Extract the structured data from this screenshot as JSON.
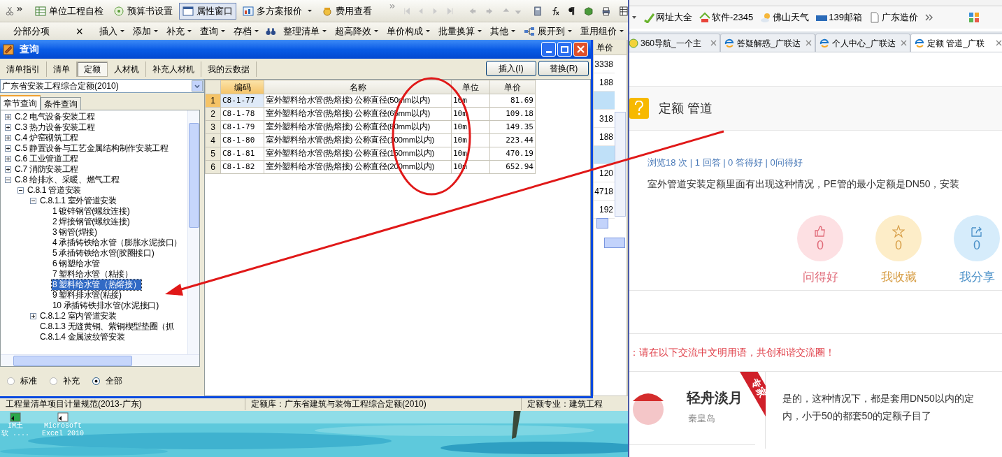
{
  "app": {
    "toolbar1": [
      {
        "label": "单位工程自检",
        "pressed": false
      },
      {
        "label": "预算书设置",
        "pressed": false
      },
      {
        "label": "属性窗口",
        "pressed": true
      },
      {
        "label": "多方案报价",
        "pressed": false
      },
      {
        "label": "费用查看",
        "pressed": false
      }
    ],
    "panel_title": "分部分项",
    "panel_close": "×",
    "toolbar2": [
      "插入",
      "添加",
      "补充",
      "查询",
      "存档",
      "整理清单",
      "超高降效",
      "单价构成",
      "批量换算",
      "其他",
      "展开到",
      "重用组价"
    ],
    "side_column": {
      "header": "单价",
      "values": [
        {
          "text": "3338",
          "highlight": false
        },
        {
          "text": "188",
          "highlight": false
        },
        {
          "highlight": true
        },
        {
          "text": "318",
          "highlight": false
        },
        {
          "text": "188",
          "highlight": false
        },
        {
          "highlight": true
        },
        {
          "text": "120",
          "highlight": false
        },
        {
          "text": "4718",
          "highlight": false
        },
        {
          "text": "192",
          "highlight": false
        }
      ]
    },
    "status_bar": [
      "工程量清单项目计量规范(2013-广东)",
      "定额库：广东省建筑与装饰工程综合定额(2010)",
      "定额专业：建筑工程"
    ]
  },
  "dialog": {
    "title": "查询",
    "tabs": [
      {
        "label": "清单指引",
        "selected": false
      },
      {
        "label": "清单",
        "selected": false
      },
      {
        "label": "定额",
        "selected": true
      },
      {
        "label": "人材机",
        "selected": false
      },
      {
        "label": "补充人材机",
        "selected": false
      },
      {
        "label": "我的云数据",
        "selected": false
      }
    ],
    "buttons": [
      "插入(I)",
      "替换(R)"
    ],
    "library": "广东省安装工程综合定额(2010)",
    "subtabs": [
      {
        "label": "章节查询",
        "selected": true
      },
      {
        "label": "条件查询",
        "selected": false
      }
    ],
    "tree": [
      {
        "label": "C.2 电气设备安装工程",
        "expanded": false,
        "selected": false
      },
      {
        "label": "C.3 热力设备安装工程",
        "expanded": false,
        "selected": false
      },
      {
        "label": "C.4 炉窑砌筑工程",
        "expanded": false,
        "selected": false
      },
      {
        "label": "C.5 静置设备与工艺金属结构制作安装工程",
        "expanded": false,
        "selected": false
      },
      {
        "label": "C.6 工业管道工程",
        "expanded": false,
        "selected": false
      },
      {
        "label": "C.7 消防安装工程",
        "expanded": false,
        "selected": false
      },
      {
        "label": "C.8 给排水、采暖、燃气工程",
        "expanded": true,
        "selected": false,
        "children": [
          {
            "label": "C.8.1 管道安装",
            "expanded": true,
            "selected": false,
            "children": [
              {
                "label": "C.8.1.1 室外管道安装",
                "expanded": true,
                "selected": false,
                "children": [
                  {
                    "label": "1 镀锌钢管(螺纹连接)",
                    "selected": false
                  },
                  {
                    "label": "2 焊接钢管(螺纹连接)",
                    "selected": false
                  },
                  {
                    "label": "3 钢管(焊接)",
                    "selected": false
                  },
                  {
                    "label": "4 承插铸铁给水管（膨胀水泥接口）",
                    "selected": false
                  },
                  {
                    "label": "5 承插铸铁给水管(胶圈接口)",
                    "selected": false
                  },
                  {
                    "label": "6 钢塑给水管",
                    "selected": false
                  },
                  {
                    "label": "7 塑料给水管（粘接）",
                    "selected": false
                  },
                  {
                    "label": "8 塑料给水管（热熔接）",
                    "selected": true
                  },
                  {
                    "label": "9 塑料排水管(粘接)",
                    "selected": false
                  },
                  {
                    "label": "10 承插铸铁排水管(水泥接口)",
                    "selected": false
                  }
                ]
              },
              {
                "label": "C.8.1.2 室内管道安装",
                "expanded": false,
                "selected": false
              },
              {
                "label": "C.8.1.3 无缝黄铜、紫铜楔型垫圈（抓",
                "selected": false
              },
              {
                "label": "C.8.1.4 金属波纹管安装",
                "selected": false
              }
            ]
          }
        ]
      }
    ],
    "filters": [
      {
        "label": "标准",
        "selected": false
      },
      {
        "label": "补充",
        "selected": false
      },
      {
        "label": "全部",
        "selected": true
      }
    ],
    "table": {
      "columns": [
        {
          "label": "编码",
          "active": true
        },
        {
          "label": "名称",
          "active": false
        },
        {
          "label": "单位",
          "active": false
        },
        {
          "label": "单价",
          "active": false
        }
      ],
      "rows": [
        {
          "no": "1",
          "code": "C8-1-77",
          "name": "室外塑料给水管(热熔接) 公称直径(50mm以内)",
          "unit": "10m",
          "price": "81.69",
          "selected": true
        },
        {
          "no": "2",
          "code": "C8-1-78",
          "name": "室外塑料给水管(热熔接) 公称直径(65mm以内)",
          "unit": "10m",
          "price": "109.18",
          "selected": false
        },
        {
          "no": "3",
          "code": "C8-1-79",
          "name": "室外塑料给水管(热熔接) 公称直径(80mm以内)",
          "unit": "10m",
          "price": "149.35",
          "selected": false
        },
        {
          "no": "4",
          "code": "C8-1-80",
          "name": "室外塑料给水管(热熔接) 公称直径(100mm以内)",
          "unit": "10m",
          "price": "223.44",
          "selected": false
        },
        {
          "no": "5",
          "code": "C8-1-81",
          "name": "室外塑料给水管(热熔接) 公称直径(150mm以内)",
          "unit": "10m",
          "price": "470.19",
          "selected": false
        },
        {
          "no": "6",
          "code": "C8-1-82",
          "name": "室外塑料给水管(热熔接) 公称直径(200mm以内)",
          "unit": "10m",
          "price": "652.94",
          "selected": false
        }
      ]
    }
  },
  "desktop": {
    "icons": [
      {
        "lines": [
          "IM土",
          "软 ...."
        ]
      },
      {
        "lines": [
          "Microsoft",
          "Excel 2010"
        ]
      }
    ]
  },
  "browser": {
    "bookmarks": [
      "网址大全",
      "软件-2345",
      "佛山天气",
      "139邮箱",
      "广东造价"
    ],
    "tabs": [
      {
        "label": "360导航_一个主",
        "selected": false
      },
      {
        "label": "答疑解惑_广联达",
        "selected": false
      },
      {
        "label": "个人中心_广联达",
        "selected": false
      },
      {
        "label": "定额 管道_广联",
        "selected": true
      }
    ],
    "question": {
      "title": "定额 管道",
      "stats": "浏览18 次 | 1 回答 | 0 答得好 | 0问得好",
      "text": "室外管道安装定额里面有出现这种情况，PE管的最小定额是DN50，安装"
    },
    "actions": [
      {
        "kind": "like",
        "count": "0",
        "label": "问得好"
      },
      {
        "kind": "favorite",
        "count": "0",
        "label": "我收藏"
      },
      {
        "kind": "share",
        "count": "0",
        "label": "我分享"
      }
    ],
    "notice": "：请在以下交流中文明用语，共创和谐交流圈！",
    "answer": {
      "name": "轻舟淡月",
      "badge": "专家",
      "location": "秦皇岛",
      "lines": [
        "是的，这种情况下，都是套用DN50以内的定",
        "内，小于50的都套50的定额子目了"
      ]
    }
  }
}
